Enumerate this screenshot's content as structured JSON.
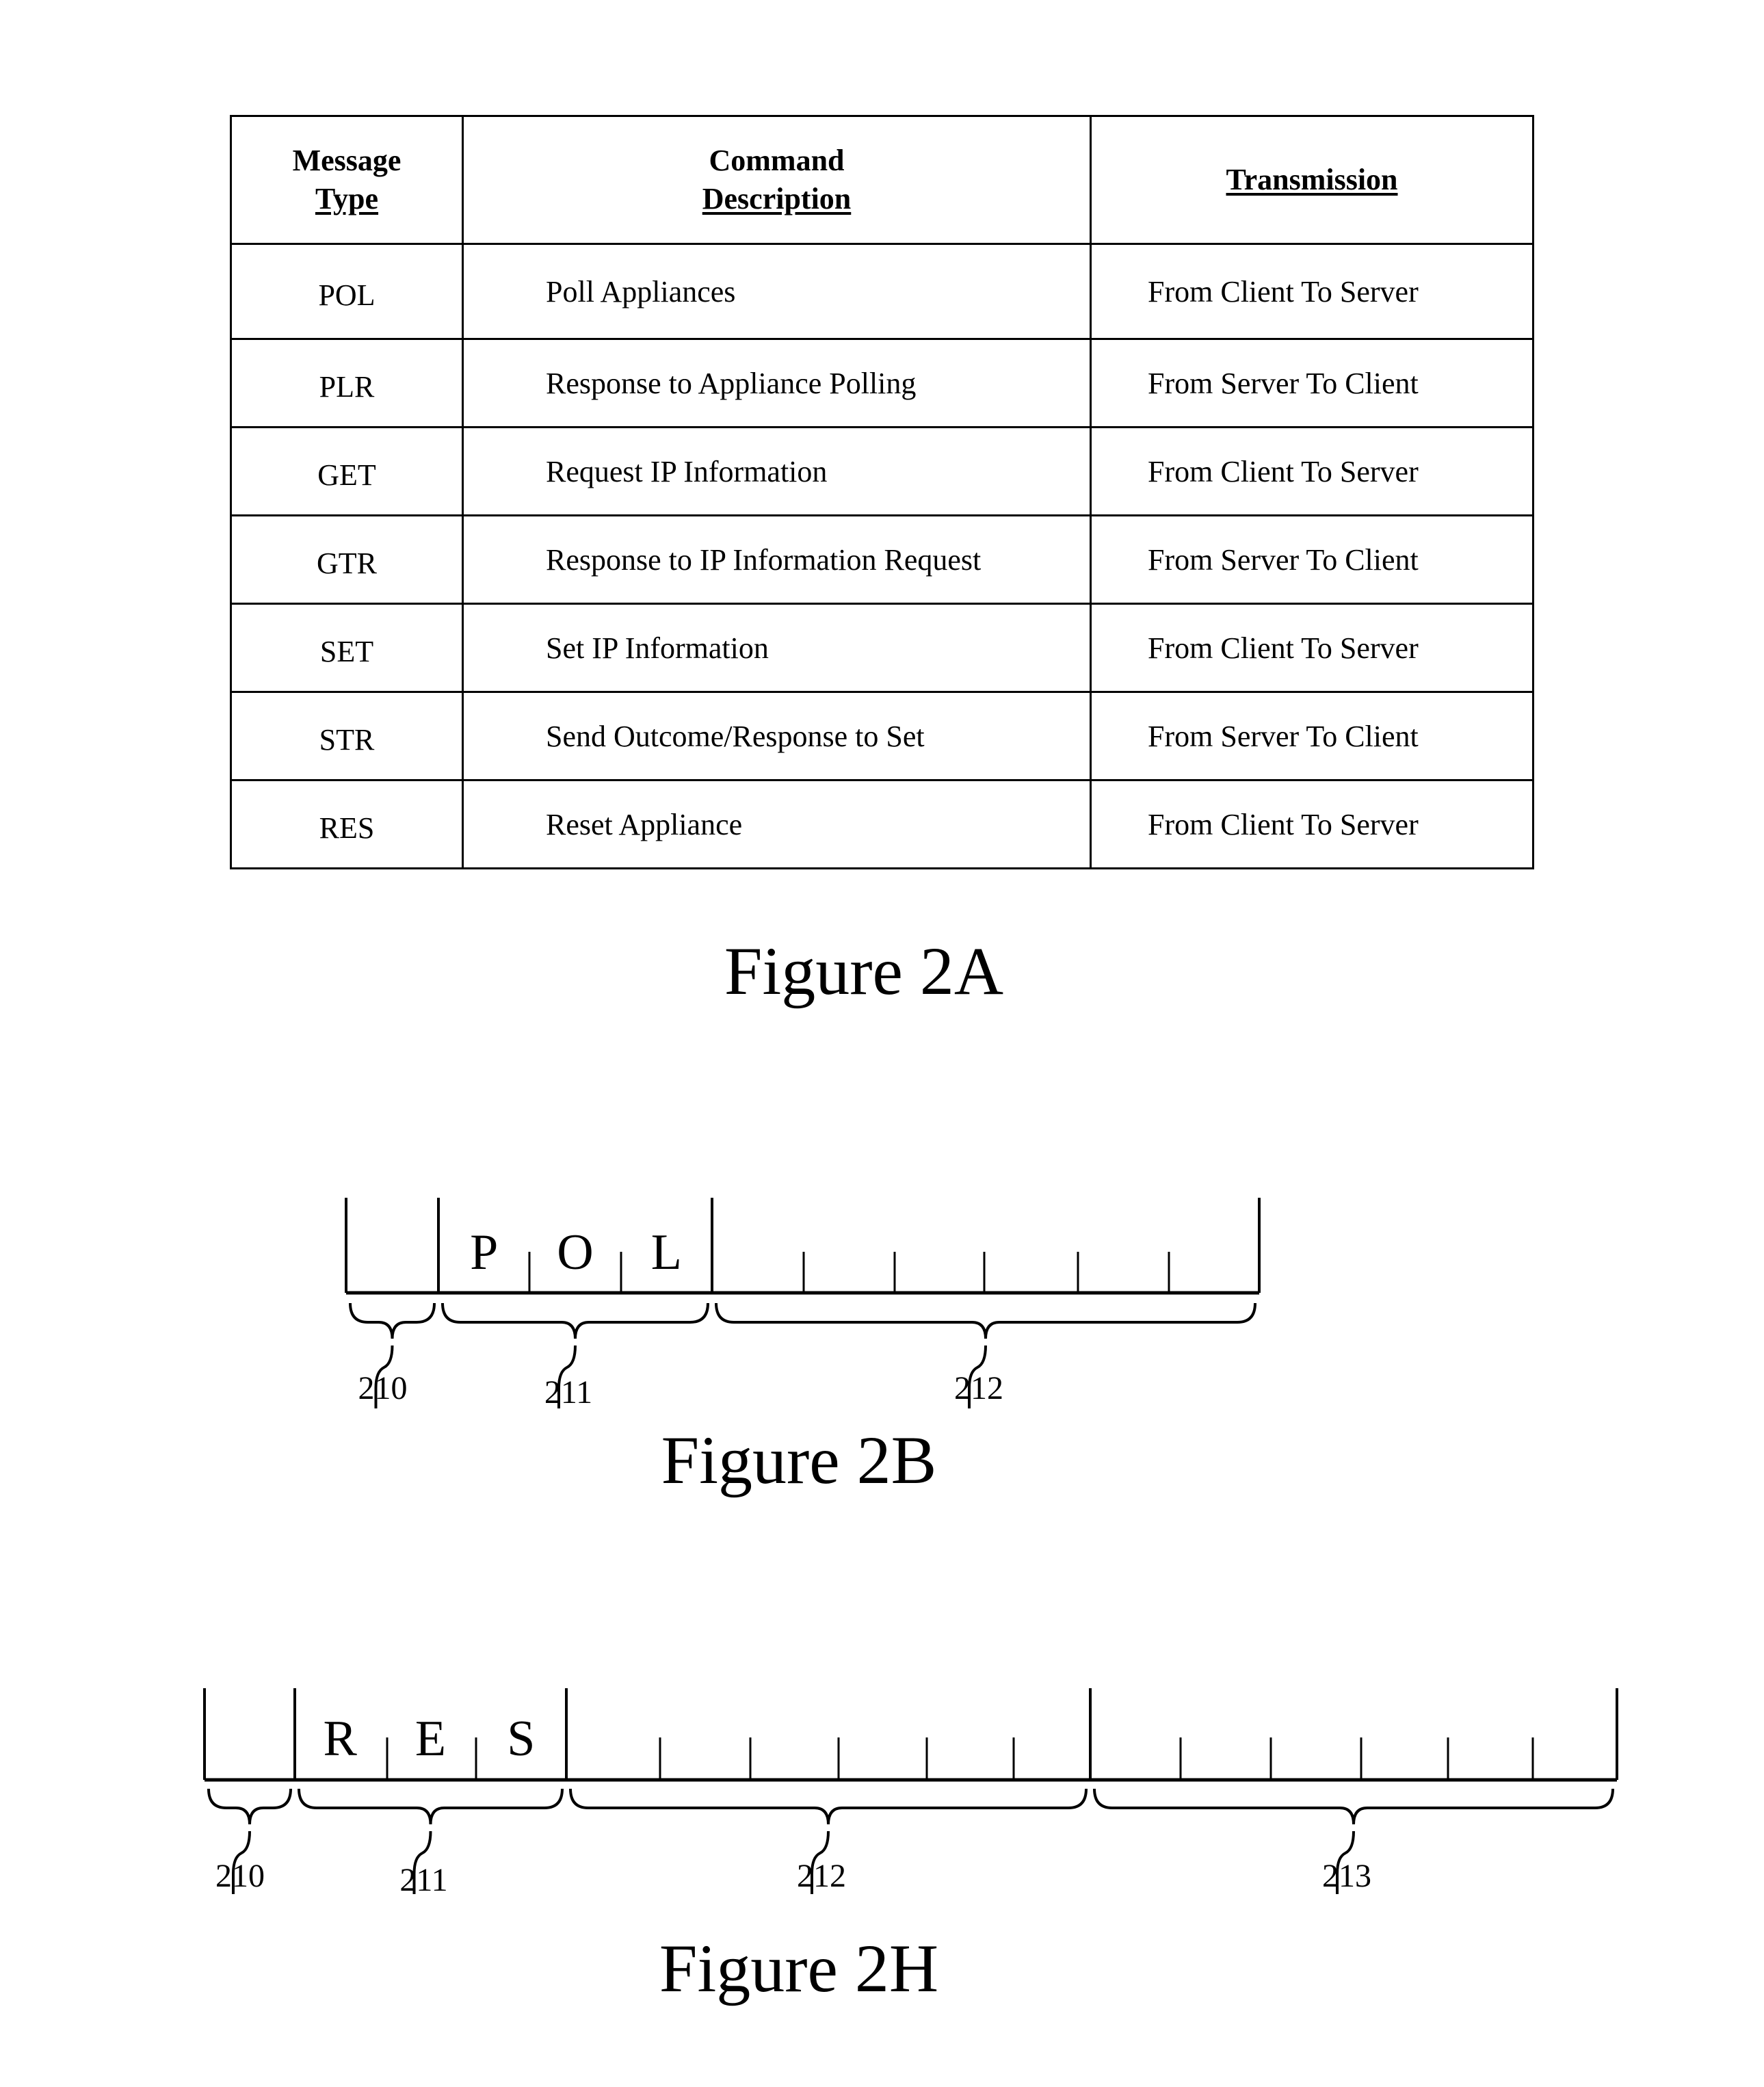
{
  "figure_2a": {
    "headers": [
      {
        "line1": "Message",
        "line2": "Type"
      },
      {
        "line1": "Command",
        "line2": "Description"
      },
      {
        "line1": "",
        "line2": "Transmission"
      }
    ],
    "rows": [
      {
        "type": "POL",
        "description": "Poll Appliances",
        "transmission": "From Client To Server"
      },
      {
        "type": "PLR",
        "description": "Response to Appliance Polling",
        "transmission": "From Server To Client"
      },
      {
        "type": "GET",
        "description": "Request IP Information",
        "transmission": "From Client To Server"
      },
      {
        "type": "GTR",
        "description": "Response to IP Information Request",
        "transmission": "From Server To Client"
      },
      {
        "type": "SET",
        "description": "Set IP Information",
        "transmission": "From Client To Server"
      },
      {
        "type": "STR",
        "description": "Send Outcome/Response to Set",
        "transmission": "From Server To Client"
      },
      {
        "type": "RES",
        "description": "Reset Appliance",
        "transmission": "From Client To Server"
      }
    ],
    "caption": "Figure 2A"
  },
  "figure_2b": {
    "caption": "Figure 2B",
    "fields": [
      {
        "ref": "210",
        "letters": [],
        "subfields": 1
      },
      {
        "ref": "211",
        "letters": [
          "P",
          "O",
          "L"
        ],
        "subfields": 3
      },
      {
        "ref": "212",
        "letters": [],
        "subfields": 6
      }
    ]
  },
  "figure_2h": {
    "caption": "Figure 2H",
    "fields": [
      {
        "ref": "210",
        "letters": [],
        "subfields": 1
      },
      {
        "ref": "211",
        "letters": [
          "R",
          "E",
          "S"
        ],
        "subfields": 3
      },
      {
        "ref": "212",
        "letters": [],
        "subfields": 6
      },
      {
        "ref": "213",
        "letters": [],
        "subfields": 6
      }
    ]
  }
}
